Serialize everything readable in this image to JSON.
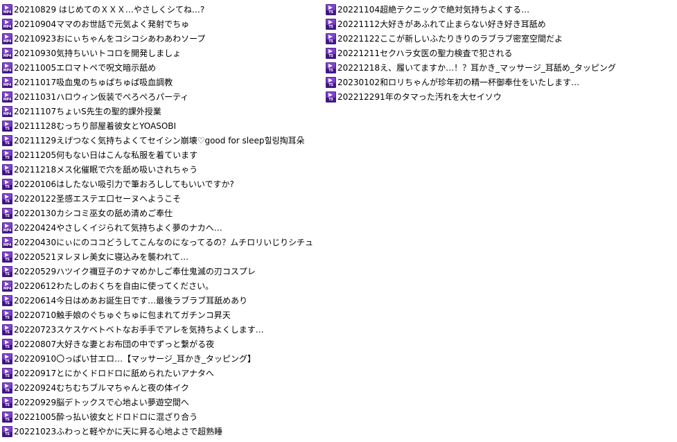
{
  "colors": {
    "icon_fill": "#6b35c0",
    "icon_dark": "#3d1580",
    "text": "#000000",
    "background": "#ffffff"
  },
  "files_left": [
    {
      "name": "20210829 はじめてのＸＸＸ…やさしくシてね…?",
      "icon": "mp4-video-icon",
      "tag": "MP4"
    },
    {
      "name": "20210904ママのお世話で元気よく発射でちゅ",
      "icon": "mp4-video-icon",
      "tag": "MP4"
    },
    {
      "name": "20210923おにぃちゃんをコシコシあわあわソープ",
      "icon": "mp4-video-icon",
      "tag": "MP4"
    },
    {
      "name": "20210930気持ちいいトコロを開発しましょ",
      "icon": "mp4-video-icon",
      "tag": "MP4"
    },
    {
      "name": "20211005エロマトペで呪文暗示舐め",
      "icon": "mp4-video-icon",
      "tag": "MP4"
    },
    {
      "name": "20211017吸血鬼のちゅぱちゅぱ吸血調教",
      "icon": "mp4-video-icon",
      "tag": "MP4"
    },
    {
      "name": "20211031ハロウィン仮装でぺろぺろパーティ",
      "icon": "mp4-video-icon",
      "tag": "MP4"
    },
    {
      "name": "20211107ちょいS先生の聖的課外授業",
      "icon": "mp4-video-icon",
      "tag": "MP4"
    },
    {
      "name": "20211128むっちり部屋着彼女とYOASOBI",
      "icon": "ts-video-icon",
      "tag": "TS"
    },
    {
      "name": "20211129えげつなく気持ちよくてセイシン崩壊♡good for sleep힐링掏耳朵",
      "icon": "ts-video-icon",
      "tag": "TS"
    },
    {
      "name": "20211205何もない日はこんな私服を着ています",
      "icon": "ts-video-icon",
      "tag": "TS"
    },
    {
      "name": "20211218メス化催眠で穴を舐め吸いされちゃう",
      "icon": "ts-video-icon",
      "tag": "TS"
    },
    {
      "name": "20220106はしたない吸引力で筆おろししてもいいですか?",
      "icon": "ts-video-icon",
      "tag": "TS"
    },
    {
      "name": "20220122圣感エステエ口セーヌへようこそ",
      "icon": "ts-video-icon",
      "tag": "TS"
    },
    {
      "name": "20220130カシコミ巫女の舐め清めご奉仕",
      "icon": "ts-video-icon",
      "tag": "TS"
    },
    {
      "name": "20220424やさしくイジられて気持ちよく夢のナカへ…",
      "icon": "mp4-video-icon",
      "tag": "MP4"
    },
    {
      "name": "20220430にぃにのココどうしてこんなのになってるの？ムチロリいじりシチュ",
      "icon": "mp4-video-icon",
      "tag": "MP4"
    },
    {
      "name": "20220521ヌレヌレ美女に寝込みを襲われて…",
      "icon": "ts-video-icon",
      "tag": "TS"
    },
    {
      "name": "20220529ハツイク禰豆子のナマめかしご奉仕鬼滅の刃コスプレ",
      "icon": "ts-video-icon",
      "tag": "TS"
    },
    {
      "name": "20220612わたしのおくちを自由に使ってください。",
      "icon": "mp4-video-icon",
      "tag": "MP4"
    },
    {
      "name": "20220614今日はめあお誕生日です…最後ラブラブ耳舐めあり",
      "icon": "ts-video-icon",
      "tag": "TS"
    },
    {
      "name": "20220710触手娘のぐちゅぐちゅに包まれてガチンコ昇天",
      "icon": "ts-video-icon",
      "tag": "TS"
    },
    {
      "name": "20220723スケスケベトベトなお手手でアレを気持ちよくします…",
      "icon": "ts-video-icon",
      "tag": "TS"
    },
    {
      "name": "20220807大好きな妻とお布団の中でずっと繋がる夜",
      "icon": "ts-video-icon",
      "tag": "TS"
    },
    {
      "name": "20220910〇っぱい甘エロ…【マッサージ_耳かき_タッピング】",
      "icon": "ts-video-icon",
      "tag": "TS"
    },
    {
      "name": "20220917とにかくドロドロに舐められたいアナタへ",
      "icon": "ts-video-icon",
      "tag": "TS"
    },
    {
      "name": "20220924むちむちブルマちゃんと夜の体イク",
      "icon": "ts-video-icon",
      "tag": "TS"
    },
    {
      "name": "20220929脳デトックスで心地よい夢遊空間へ",
      "icon": "ts-video-icon",
      "tag": "TS"
    },
    {
      "name": "20221005酔っ払い彼女とドロドロに混ざり合う",
      "icon": "ts-video-icon",
      "tag": "TS"
    },
    {
      "name": "20221023ふわっと軽やかに天に昇る心地よさで超熟睡",
      "icon": "ts-video-icon",
      "tag": "TS"
    }
  ],
  "files_right": [
    {
      "name": "20221104超絶テクニックで絶対気持ちよくする…",
      "icon": "ts-video-icon",
      "tag": "TS"
    },
    {
      "name": "20221112大好きがあふれて止まらない好き好き耳舐め",
      "icon": "ts-video-icon",
      "tag": "TS"
    },
    {
      "name": "20221122ここが新しいふたりきりのラブラブ密室空間だよ",
      "icon": "ts-video-icon",
      "tag": "TS"
    },
    {
      "name": "20221211セクハラ女医の聖力検査で犯される",
      "icon": "ts-video-icon",
      "tag": "TS"
    },
    {
      "name": "20221218え、履いてますか…！？耳かき_マッサージ_耳舐め_タッピング",
      "icon": "ts-video-icon",
      "tag": "TS"
    },
    {
      "name": "20230102和ロリちゃんが珍年初の精一杯御奉仕をいたします…",
      "icon": "ts-video-icon",
      "tag": "TS"
    },
    {
      "name": "202212291年のタマった汚れを大セイソウ",
      "icon": "ts-video-icon",
      "tag": "TS"
    }
  ]
}
